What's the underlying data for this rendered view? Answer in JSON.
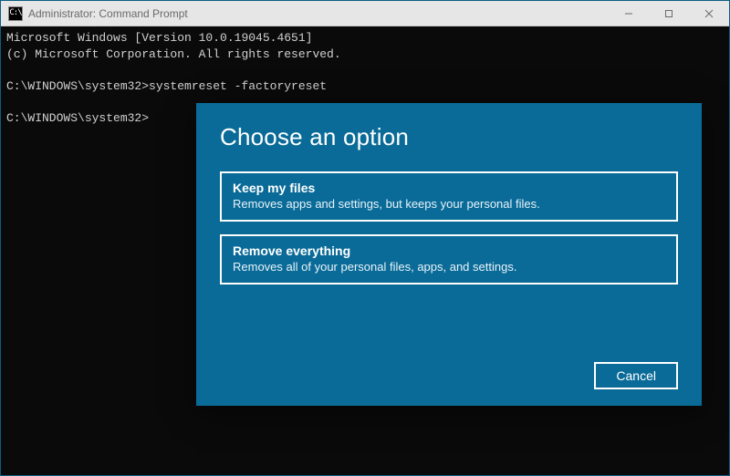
{
  "window": {
    "title": "Administrator: Command Prompt",
    "icon_label": "C:\\"
  },
  "console": {
    "line1": "Microsoft Windows [Version 10.0.19045.4651]",
    "line2": "(c) Microsoft Corporation. All rights reserved.",
    "blank": "",
    "prompt1": "C:\\WINDOWS\\system32>systemreset -factoryreset",
    "prompt2": "C:\\WINDOWS\\system32>"
  },
  "dialog": {
    "heading": "Choose an option",
    "options": [
      {
        "title": "Keep my files",
        "desc": "Removes apps and settings, but keeps your personal files."
      },
      {
        "title": "Remove everything",
        "desc": "Removes all of your personal files, apps, and settings."
      }
    ],
    "cancel": "Cancel"
  }
}
